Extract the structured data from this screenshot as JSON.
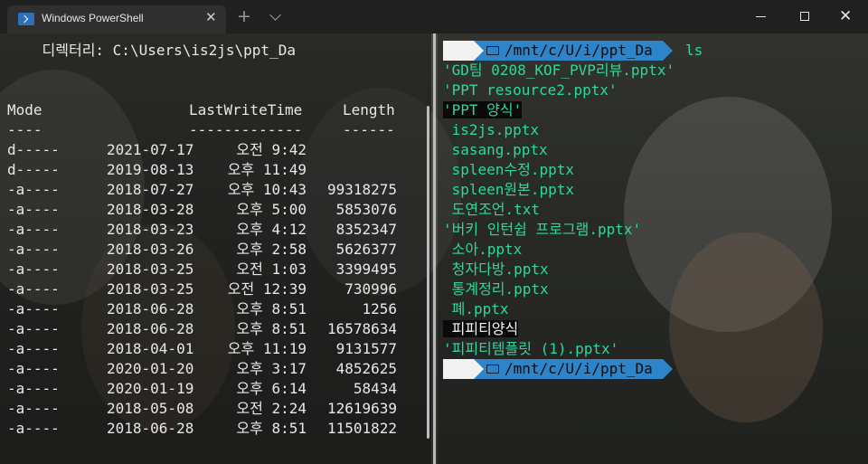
{
  "window": {
    "tab_title": "Windows PowerShell",
    "icons": {
      "tab": "powershell-icon",
      "close": "close-icon",
      "new_tab": "plus-icon",
      "dropdown": "chevron-down-icon",
      "min": "minimize-icon",
      "max": "maximize-icon",
      "win_close": "window-close-icon"
    },
    "close_glyph": "✕",
    "new_tab_glyph": "+",
    "win_close_glyph": "✕"
  },
  "left": {
    "directory_line": "    디렉터리: C:\\Users\\is2js\\ppt_Da",
    "headers": {
      "mode": "Mode",
      "time": "LastWriteTime",
      "length": "Length"
    },
    "underlines": {
      "mode": "----",
      "time": "-------------",
      "length": "------"
    },
    "rows": [
      {
        "mode": "d-----",
        "date": "2021-07-17",
        "time": "오전 9:42",
        "length": ""
      },
      {
        "mode": "d-----",
        "date": "2019-08-13",
        "time": "오후 11:49",
        "length": ""
      },
      {
        "mode": "-a----",
        "date": "2018-07-27",
        "time": "오후 10:43",
        "length": "99318275"
      },
      {
        "mode": "-a----",
        "date": "2018-03-28",
        "time": "오후 5:00",
        "length": "5853076"
      },
      {
        "mode": "-a----",
        "date": "2018-03-23",
        "time": "오후 4:12",
        "length": "8352347"
      },
      {
        "mode": "-a----",
        "date": "2018-03-26",
        "time": "오후 2:58",
        "length": "5626377"
      },
      {
        "mode": "-a----",
        "date": "2018-03-25",
        "time": "오전 1:03",
        "length": "3399495"
      },
      {
        "mode": "-a----",
        "date": "2018-03-25",
        "time": "오전 12:39",
        "length": "730996"
      },
      {
        "mode": "-a----",
        "date": "2018-06-28",
        "time": "오후 8:51",
        "length": "1256"
      },
      {
        "mode": "-a----",
        "date": "2018-06-28",
        "time": "오후 8:51",
        "length": "16578634"
      },
      {
        "mode": "-a----",
        "date": "2018-04-01",
        "time": "오후 11:19",
        "length": "9131577"
      },
      {
        "mode": "-a----",
        "date": "2020-01-20",
        "time": "오후 3:17",
        "length": "4852625"
      },
      {
        "mode": "-a----",
        "date": "2020-01-19",
        "time": "오후 6:14",
        "length": "58434"
      },
      {
        "mode": "-a----",
        "date": "2018-05-08",
        "time": "오전 2:24",
        "length": "12619639"
      },
      {
        "mode": "-a----",
        "date": "2018-06-28",
        "time": "오후 8:51",
        "length": "11501822"
      }
    ]
  },
  "right": {
    "prompt_icon": "",
    "prompt_path": "/mnt/c/U/i/ppt_Da",
    "command": "ls",
    "prompt_icons": {
      "os": "penguin-icon",
      "folder": "folder-icon"
    },
    "entries": [
      {
        "text": "'GD팀 0208_KOF_PVP리뷰.pptx'",
        "style": "plain"
      },
      {
        "text": "'PPT resource2.pptx'",
        "style": "plain"
      },
      {
        "text": "'PPT 양식'",
        "style": "dir"
      },
      {
        "text": " is2js.pptx",
        "style": "plain"
      },
      {
        "text": " sasang.pptx",
        "style": "plain"
      },
      {
        "text": " spleen수정.pptx",
        "style": "plain"
      },
      {
        "text": " spleen원본.pptx",
        "style": "plain"
      },
      {
        "text": " 도연조언.txt",
        "style": "plain"
      },
      {
        "text": "'버키 인턴쉽 프로그램.pptx'",
        "style": "plain"
      },
      {
        "text": " 소아.pptx",
        "style": "plain"
      },
      {
        "text": " 청자다방.pptx",
        "style": "plain"
      },
      {
        "text": " 통계정리.pptx",
        "style": "plain"
      },
      {
        "text": " 폐.pptx",
        "style": "plain"
      },
      {
        "text": " 피피티양식",
        "style": "dir-white"
      },
      {
        "text": "'피피티템플릿 (1).pptx'",
        "style": "plain"
      }
    ]
  }
}
